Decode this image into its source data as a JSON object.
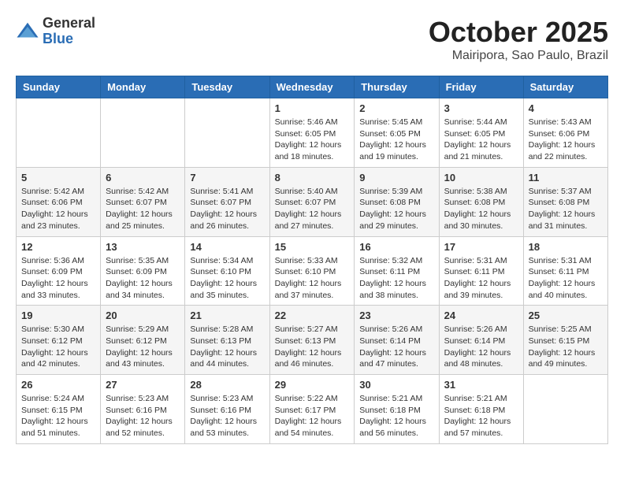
{
  "logo": {
    "general": "General",
    "blue": "Blue"
  },
  "header": {
    "month": "October 2025",
    "location": "Mairipora, Sao Paulo, Brazil"
  },
  "weekdays": [
    "Sunday",
    "Monday",
    "Tuesday",
    "Wednesday",
    "Thursday",
    "Friday",
    "Saturday"
  ],
  "weeks": [
    [
      {
        "day": "",
        "info": ""
      },
      {
        "day": "",
        "info": ""
      },
      {
        "day": "",
        "info": ""
      },
      {
        "day": "1",
        "info": "Sunrise: 5:46 AM\nSunset: 6:05 PM\nDaylight: 12 hours\nand 18 minutes."
      },
      {
        "day": "2",
        "info": "Sunrise: 5:45 AM\nSunset: 6:05 PM\nDaylight: 12 hours\nand 19 minutes."
      },
      {
        "day": "3",
        "info": "Sunrise: 5:44 AM\nSunset: 6:05 PM\nDaylight: 12 hours\nand 21 minutes."
      },
      {
        "day": "4",
        "info": "Sunrise: 5:43 AM\nSunset: 6:06 PM\nDaylight: 12 hours\nand 22 minutes."
      }
    ],
    [
      {
        "day": "5",
        "info": "Sunrise: 5:42 AM\nSunset: 6:06 PM\nDaylight: 12 hours\nand 23 minutes."
      },
      {
        "day": "6",
        "info": "Sunrise: 5:42 AM\nSunset: 6:07 PM\nDaylight: 12 hours\nand 25 minutes."
      },
      {
        "day": "7",
        "info": "Sunrise: 5:41 AM\nSunset: 6:07 PM\nDaylight: 12 hours\nand 26 minutes."
      },
      {
        "day": "8",
        "info": "Sunrise: 5:40 AM\nSunset: 6:07 PM\nDaylight: 12 hours\nand 27 minutes."
      },
      {
        "day": "9",
        "info": "Sunrise: 5:39 AM\nSunset: 6:08 PM\nDaylight: 12 hours\nand 29 minutes."
      },
      {
        "day": "10",
        "info": "Sunrise: 5:38 AM\nSunset: 6:08 PM\nDaylight: 12 hours\nand 30 minutes."
      },
      {
        "day": "11",
        "info": "Sunrise: 5:37 AM\nSunset: 6:08 PM\nDaylight: 12 hours\nand 31 minutes."
      }
    ],
    [
      {
        "day": "12",
        "info": "Sunrise: 5:36 AM\nSunset: 6:09 PM\nDaylight: 12 hours\nand 33 minutes."
      },
      {
        "day": "13",
        "info": "Sunrise: 5:35 AM\nSunset: 6:09 PM\nDaylight: 12 hours\nand 34 minutes."
      },
      {
        "day": "14",
        "info": "Sunrise: 5:34 AM\nSunset: 6:10 PM\nDaylight: 12 hours\nand 35 minutes."
      },
      {
        "day": "15",
        "info": "Sunrise: 5:33 AM\nSunset: 6:10 PM\nDaylight: 12 hours\nand 37 minutes."
      },
      {
        "day": "16",
        "info": "Sunrise: 5:32 AM\nSunset: 6:11 PM\nDaylight: 12 hours\nand 38 minutes."
      },
      {
        "day": "17",
        "info": "Sunrise: 5:31 AM\nSunset: 6:11 PM\nDaylight: 12 hours\nand 39 minutes."
      },
      {
        "day": "18",
        "info": "Sunrise: 5:31 AM\nSunset: 6:11 PM\nDaylight: 12 hours\nand 40 minutes."
      }
    ],
    [
      {
        "day": "19",
        "info": "Sunrise: 5:30 AM\nSunset: 6:12 PM\nDaylight: 12 hours\nand 42 minutes."
      },
      {
        "day": "20",
        "info": "Sunrise: 5:29 AM\nSunset: 6:12 PM\nDaylight: 12 hours\nand 43 minutes."
      },
      {
        "day": "21",
        "info": "Sunrise: 5:28 AM\nSunset: 6:13 PM\nDaylight: 12 hours\nand 44 minutes."
      },
      {
        "day": "22",
        "info": "Sunrise: 5:27 AM\nSunset: 6:13 PM\nDaylight: 12 hours\nand 46 minutes."
      },
      {
        "day": "23",
        "info": "Sunrise: 5:26 AM\nSunset: 6:14 PM\nDaylight: 12 hours\nand 47 minutes."
      },
      {
        "day": "24",
        "info": "Sunrise: 5:26 AM\nSunset: 6:14 PM\nDaylight: 12 hours\nand 48 minutes."
      },
      {
        "day": "25",
        "info": "Sunrise: 5:25 AM\nSunset: 6:15 PM\nDaylight: 12 hours\nand 49 minutes."
      }
    ],
    [
      {
        "day": "26",
        "info": "Sunrise: 5:24 AM\nSunset: 6:15 PM\nDaylight: 12 hours\nand 51 minutes."
      },
      {
        "day": "27",
        "info": "Sunrise: 5:23 AM\nSunset: 6:16 PM\nDaylight: 12 hours\nand 52 minutes."
      },
      {
        "day": "28",
        "info": "Sunrise: 5:23 AM\nSunset: 6:16 PM\nDaylight: 12 hours\nand 53 minutes."
      },
      {
        "day": "29",
        "info": "Sunrise: 5:22 AM\nSunset: 6:17 PM\nDaylight: 12 hours\nand 54 minutes."
      },
      {
        "day": "30",
        "info": "Sunrise: 5:21 AM\nSunset: 6:18 PM\nDaylight: 12 hours\nand 56 minutes."
      },
      {
        "day": "31",
        "info": "Sunrise: 5:21 AM\nSunset: 6:18 PM\nDaylight: 12 hours\nand 57 minutes."
      },
      {
        "day": "",
        "info": ""
      }
    ]
  ]
}
